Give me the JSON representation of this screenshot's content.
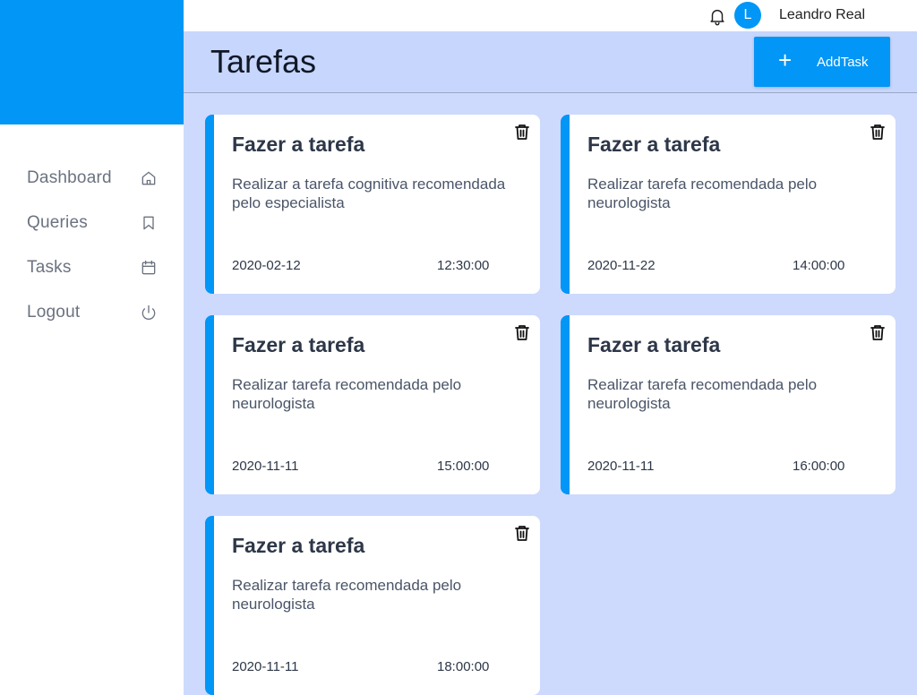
{
  "sidebar": {
    "items": [
      {
        "label": "Dashboard",
        "icon": "home-icon"
      },
      {
        "label": "Queries",
        "icon": "bookmark-icon"
      },
      {
        "label": "Tasks",
        "icon": "calendar-icon"
      },
      {
        "label": "Logout",
        "icon": "power-icon"
      }
    ]
  },
  "topbar": {
    "notification_icon": "bell-icon",
    "avatar_initial": "L",
    "user_name": "Leandro Real"
  },
  "header": {
    "title": "Tarefas",
    "add_button_icon": "+",
    "add_button_label": "AddTask"
  },
  "tasks": [
    {
      "title": "Fazer a tarefa",
      "description": "Realizar a tarefa cognitiva recomendada pelo especialista",
      "date": "2020-02-12",
      "time": "12:30:00"
    },
    {
      "title": "Fazer a tarefa",
      "description": "Realizar tarefa recomendada pelo neurologista",
      "date": "2020-11-22",
      "time": "14:00:00"
    },
    {
      "title": "Fazer a tarefa",
      "description": "Realizar tarefa recomendada pelo neurologista",
      "date": "2020-11-11",
      "time": "15:00:00"
    },
    {
      "title": "Fazer a tarefa",
      "description": "Realizar tarefa recomendada pelo neurologista",
      "date": "2020-11-11",
      "time": "16:00:00"
    },
    {
      "title": "Fazer a tarefa",
      "description": "Realizar tarefa recomendada pelo neurologista",
      "date": "2020-11-11",
      "time": "18:00:00"
    }
  ],
  "colors": {
    "accent": "#0296f6",
    "main_background": "#cddafd",
    "card_background": "#ffffff"
  }
}
